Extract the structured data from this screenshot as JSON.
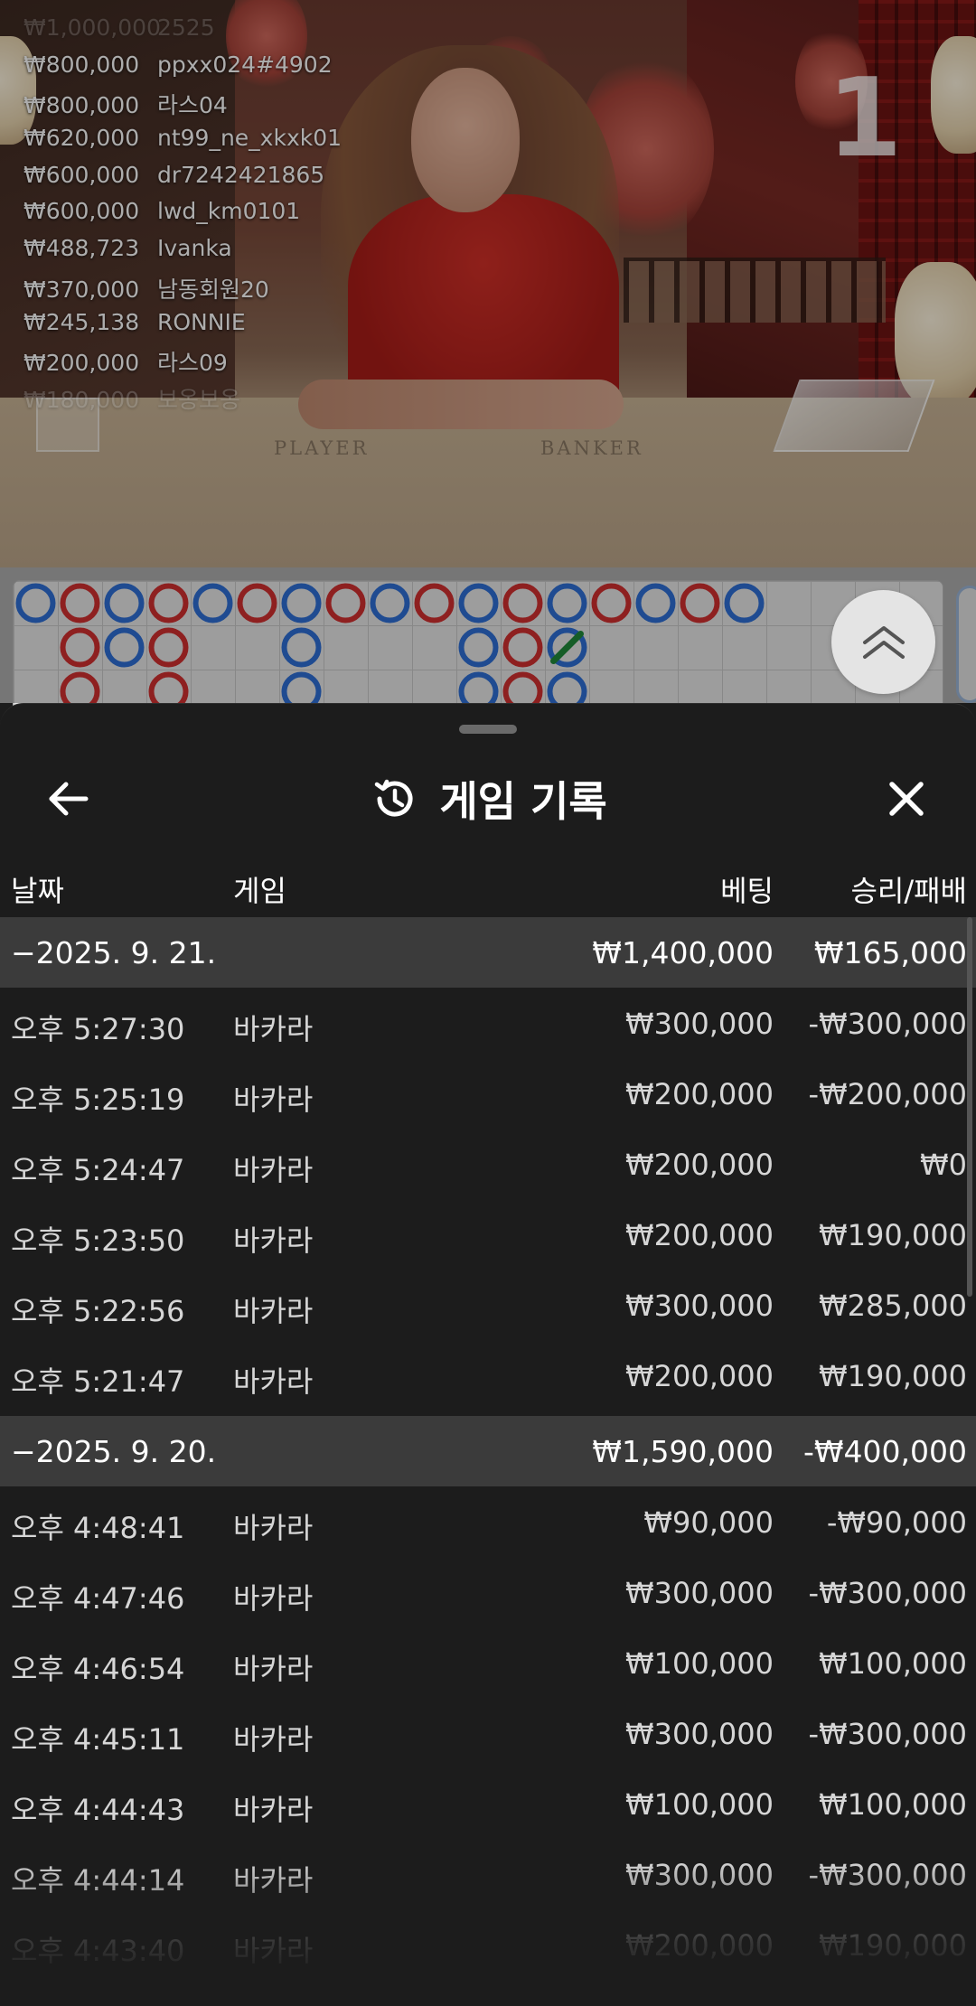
{
  "video": {
    "round_number": "1",
    "table_labels": {
      "player": "PLAYER",
      "banker": "BANKER"
    },
    "winners": [
      {
        "amount": "₩1,000,000",
        "name": "2525"
      },
      {
        "amount": "₩800,000",
        "name": "ppxx024#4902"
      },
      {
        "amount": "₩800,000",
        "name": "라스04"
      },
      {
        "amount": "₩620,000",
        "name": "nt99_ne_xkxk01"
      },
      {
        "amount": "₩600,000",
        "name": "dr7242421865"
      },
      {
        "amount": "₩600,000",
        "name": "lwd_km0101"
      },
      {
        "amount": "₩488,723",
        "name": "Ivanka"
      },
      {
        "amount": "₩370,000",
        "name": "남동회원20"
      },
      {
        "amount": "₩245,138",
        "name": "RONNIE"
      },
      {
        "amount": "₩200,000",
        "name": "라스09"
      },
      {
        "amount": "₩180,000",
        "name": "보옹보옹"
      }
    ]
  },
  "roadmap": {
    "colors": {
      "player": "#2f6fd6",
      "banker": "#d13030",
      "tie": "#1f8a3a"
    },
    "columns": [
      [
        "P"
      ],
      [
        "B",
        "B",
        "B"
      ],
      [
        "P",
        "P"
      ],
      [
        "B",
        "B",
        "B"
      ],
      [
        "P"
      ],
      [
        "B"
      ],
      [
        "P",
        "P",
        "P"
      ],
      [
        "B"
      ],
      [
        "P"
      ],
      [
        "B"
      ],
      [
        "P",
        "P",
        "P"
      ],
      [
        "B",
        "B",
        "B"
      ],
      [
        "P",
        "T",
        "P"
      ],
      [
        "B"
      ],
      [
        "P"
      ],
      [
        "B"
      ],
      [
        "P"
      ]
    ]
  },
  "sheet": {
    "title": "게임 기록",
    "icons": {
      "back": "arrow-left-icon",
      "history": "history-icon",
      "close": "close-icon",
      "scroll_up": "double-chevron-up-icon"
    },
    "columns": {
      "date": "날짜",
      "game": "게임",
      "bet": "베팅",
      "result": "승리/패배"
    },
    "groups": [
      {
        "date": "−2025. 9. 21.",
        "bet_total": "₩1,400,000",
        "result_total": "₩165,000",
        "rows": [
          {
            "time": "오후 5:27:30",
            "game": "바카라",
            "bet": "₩300,000",
            "result": "-₩300,000"
          },
          {
            "time": "오후 5:25:19",
            "game": "바카라",
            "bet": "₩200,000",
            "result": "-₩200,000"
          },
          {
            "time": "오후 5:24:47",
            "game": "바카라",
            "bet": "₩200,000",
            "result": "₩0"
          },
          {
            "time": "오후 5:23:50",
            "game": "바카라",
            "bet": "₩200,000",
            "result": "₩190,000"
          },
          {
            "time": "오후 5:22:56",
            "game": "바카라",
            "bet": "₩300,000",
            "result": "₩285,000"
          },
          {
            "time": "오후 5:21:47",
            "game": "바카라",
            "bet": "₩200,000",
            "result": "₩190,000"
          }
        ]
      },
      {
        "date": "−2025. 9. 20.",
        "bet_total": "₩1,590,000",
        "result_total": "-₩400,000",
        "rows": [
          {
            "time": "오후 4:48:41",
            "game": "바카라",
            "bet": "₩90,000",
            "result": "-₩90,000"
          },
          {
            "time": "오후 4:47:46",
            "game": "바카라",
            "bet": "₩300,000",
            "result": "-₩300,000"
          },
          {
            "time": "오후 4:46:54",
            "game": "바카라",
            "bet": "₩100,000",
            "result": "₩100,000"
          },
          {
            "time": "오후 4:45:11",
            "game": "바카라",
            "bet": "₩300,000",
            "result": "-₩300,000"
          },
          {
            "time": "오후 4:44:43",
            "game": "바카라",
            "bet": "₩100,000",
            "result": "₩100,000"
          },
          {
            "time": "오후 4:44:14",
            "game": "바카라",
            "bet": "₩300,000",
            "result": "-₩300,000"
          },
          {
            "time": "오후 4:43:40",
            "game": "바카라",
            "bet": "₩200,000",
            "result": "₩190,000"
          }
        ]
      }
    ]
  }
}
